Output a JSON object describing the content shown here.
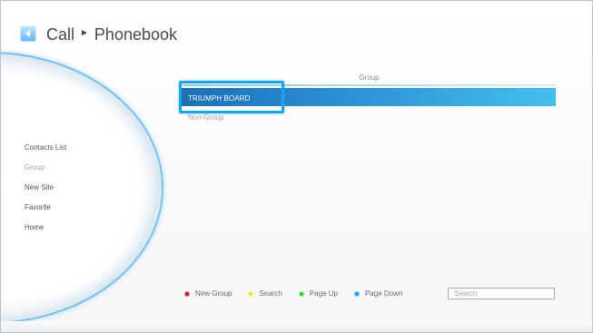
{
  "header": {
    "breadcrumb": [
      "Call",
      "Phonebook"
    ],
    "separator": "►"
  },
  "sidebar": {
    "items": [
      {
        "label": "Contacts List",
        "active": false
      },
      {
        "label": "Group",
        "active": true
      },
      {
        "label": "New Site",
        "active": false
      },
      {
        "label": "Favorite",
        "active": false
      },
      {
        "label": "Home",
        "active": false
      }
    ]
  },
  "content": {
    "column_header": "Group",
    "rows": [
      {
        "label": "TRIUMPH BOARD",
        "selected": true
      },
      {
        "label": "Non-Group",
        "selected": false
      }
    ]
  },
  "footer": {
    "legend": [
      {
        "label": "New Group",
        "color": "#c81e2c"
      },
      {
        "label": "Search",
        "color": "#f2df2a"
      },
      {
        "label": "Page Up",
        "color": "#47c83f"
      },
      {
        "label": "Page Down",
        "color": "#1f9fe8"
      }
    ],
    "search_placeholder": "Search"
  },
  "icons": {
    "back": "back-icon"
  },
  "colors": {
    "accent": "#1da4e6",
    "selection_bar_start": "#1d6fb3",
    "selection_bar_end": "#43c0ec"
  }
}
